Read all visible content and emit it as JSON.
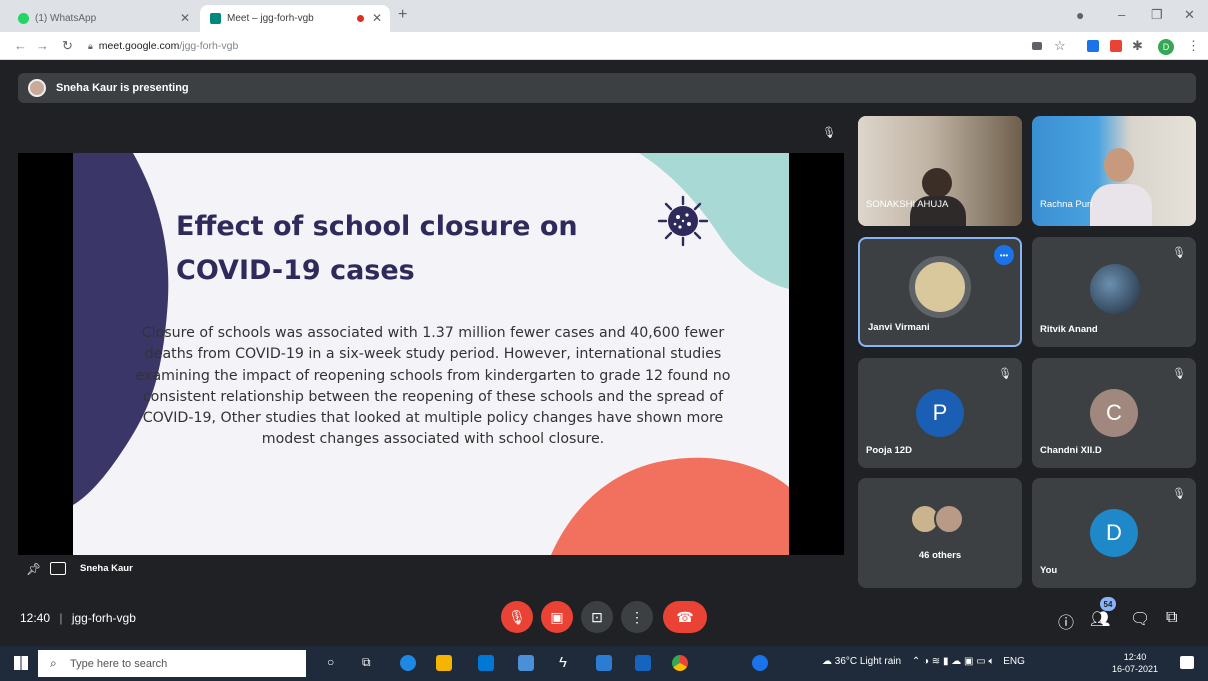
{
  "browser": {
    "tabs": [
      {
        "label": "(1) WhatsApp",
        "active": false
      },
      {
        "label": "Meet – jgg-forh-vgb",
        "active": true
      }
    ],
    "url_host": "meet.google.com",
    "url_path": "/jgg-forh-vgb",
    "profile_initial": "D"
  },
  "meet": {
    "presenting_banner": "Sneha Kaur is presenting",
    "presenter_name": "Sneha Kaur",
    "time": "12:40",
    "meeting_code": "jgg-forh-vgb",
    "participants_badge": "54",
    "slide": {
      "title": "Effect of school closure on COVID-19 cases",
      "body": "Closure of schools was associated with 1.37 million fewer cases and 40,600 fewer deaths from COVID-19 in a six-week study period. However, international studies examining the impact of reopening schools from kindergarten to grade 12 found no consistent relationship between the reopening of these schools and the spread of COVID-19, Other studies that looked at multiple policy changes have shown more modest changes associated with school closure."
    },
    "tiles": [
      {
        "name": "SONAKSHI AHUJA"
      },
      {
        "name": "Rachna Puri"
      },
      {
        "name": "Janvi Virmani"
      },
      {
        "name": "Ritvik Anand"
      },
      {
        "name": "Pooja 12D",
        "initial": "P",
        "color": "#1a5fb4"
      },
      {
        "name": "Chandni XII.D",
        "initial": "C",
        "color": "#a1887f"
      },
      {
        "name": "46 others"
      },
      {
        "name": "You",
        "initial": "D",
        "color": "#1e88c8"
      }
    ]
  },
  "taskbar": {
    "search_placeholder": "Type here to search",
    "weather": "36°C Light rain",
    "lang": "ENG",
    "clock_time": "12:40",
    "clock_date": "16-07-2021"
  }
}
